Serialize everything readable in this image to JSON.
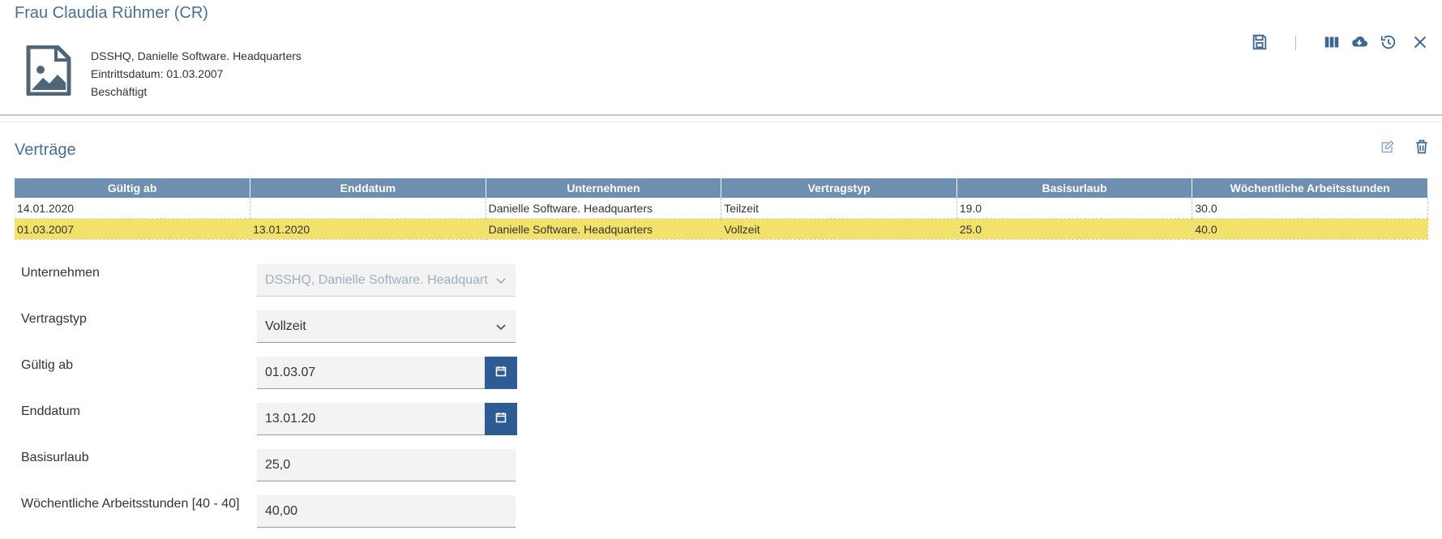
{
  "header": {
    "title": "Frau Claudia Rühmer (CR)",
    "avatar_icon": "image-placeholder-icon",
    "company": "DSSHQ, Danielle Software. Headquarters",
    "entry_date": "Eintrittsdatum: 01.03.2007",
    "status": "Beschäftigt"
  },
  "toolbar": {
    "icons": [
      "save-icon",
      "columns-icon",
      "cloud-download-icon",
      "history-icon",
      "close-icon"
    ]
  },
  "section": {
    "title": "Verträge",
    "icons": [
      "edit-icon",
      "trash-icon"
    ]
  },
  "table": {
    "headers": [
      "Gültig ab",
      "Enddatum",
      "Unternehmen",
      "Vertragstyp",
      "Basisurlaub",
      "Wöchentliche Arbeitsstunden"
    ],
    "rows": [
      [
        "14.01.2020",
        "",
        "Danielle Software. Headquarters",
        "Teilzeit",
        "19.0",
        "30.0"
      ],
      [
        "01.03.2007",
        "13.01.2020",
        "Danielle Software. Headquarters",
        "Vollzeit",
        "25.0",
        "40.0"
      ]
    ],
    "selected_row": 1,
    "selected_color": "#f3e26a",
    "header_color": "#6e8fb0"
  },
  "form": {
    "unternehmen": {
      "label": "Unternehmen",
      "value": "DSSHQ, Danielle Software. Headquarters"
    },
    "vertragstyp": {
      "label": "Vertragstyp",
      "value": "Vollzeit"
    },
    "gueltig_ab": {
      "label": "Gültig ab",
      "value": "01.03.07"
    },
    "enddatum": {
      "label": "Enddatum",
      "value": "13.01.20"
    },
    "basisurlaub": {
      "label": "Basisurlaub",
      "value": "25,0"
    },
    "wochenstunden": {
      "label": "Wöchentliche Arbeitsstunden [40 - 40]",
      "value": "40,00"
    }
  },
  "colors": {
    "accent": "#2e5b93",
    "title": "#4a6f94"
  }
}
